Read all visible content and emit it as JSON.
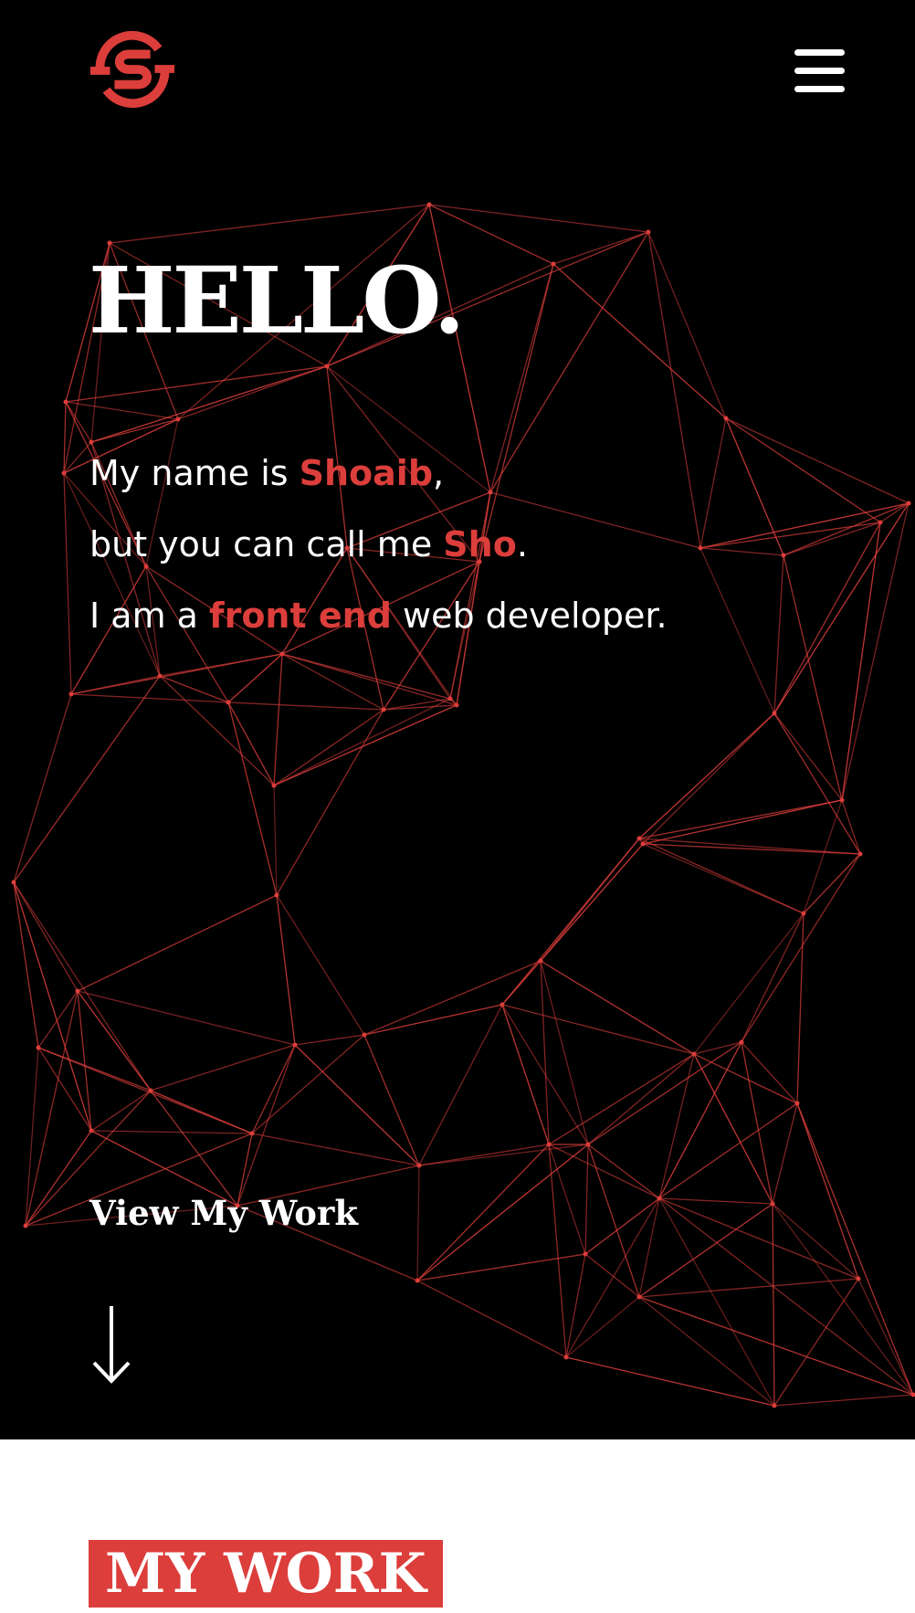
{
  "colors": {
    "background": "#000000",
    "accent": "#dc3e3b",
    "text": "#ffffff",
    "section_background": "#ffffff"
  },
  "header": {
    "logo_icon": "s-monogram-logo-icon",
    "menu_icon": "hamburger-menu-icon"
  },
  "hero": {
    "heading": "HELLO.",
    "line1": {
      "before": "My name is ",
      "highlight": "Shoaib",
      "after": ","
    },
    "line2": {
      "before": "but you can call me ",
      "highlight": "Sho",
      "after": "."
    },
    "line3": {
      "before": "I am a ",
      "highlight": "front end",
      "after": " web developer."
    },
    "cta_label": "View My Work",
    "cta_icon": "arrow-down-icon",
    "background_graphic": "polygon-network-graphic"
  },
  "work": {
    "title": "MY WORK"
  }
}
